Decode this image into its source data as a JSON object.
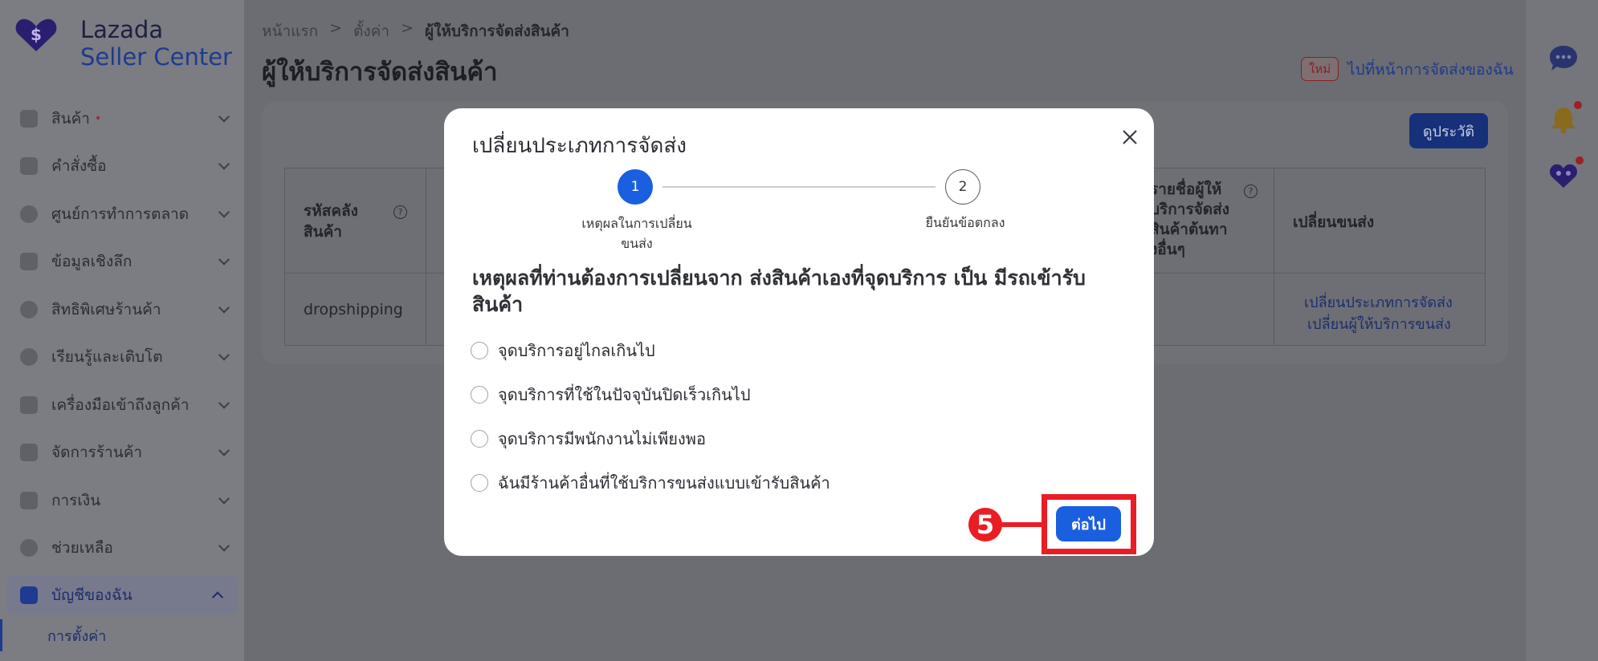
{
  "brand": {
    "line1": "Lazada",
    "line2": "Seller Center"
  },
  "sidebar": {
    "items": [
      {
        "label": "สินค้า",
        "badge": "•"
      },
      {
        "label": "คำสั่งซื้อ"
      },
      {
        "label": "ศูนย์การทำการตลาด"
      },
      {
        "label": "ข้อมูลเชิงลึก"
      },
      {
        "label": "สิทธิพิเศษร้านค้า"
      },
      {
        "label": "เรียนรู้และเติบโต"
      },
      {
        "label": "เครื่องมือเข้าถึงลูกค้า"
      },
      {
        "label": "จัดการร้านค้า"
      },
      {
        "label": "การเงิน"
      },
      {
        "label": "ช่วยเหลือ"
      },
      {
        "label": "บัญชีของฉัน"
      }
    ],
    "sub_item": "การตั้งค่า"
  },
  "breadcrumb": {
    "home": "หน้าแรก",
    "settings": "ตั้งค่า",
    "current": "ผู้ให้บริการจัดส่งสินค้า",
    "sep": ">"
  },
  "page": {
    "title": "ผู้ให้บริการจัดส่งสินค้า",
    "new_badge": "ใหม่",
    "goto_link": "ไปที่หน้าการจัดส่งของฉัน",
    "history_button": "ดูประวัติ"
  },
  "table": {
    "col_warehouse": "รหัสคลังสินค้า",
    "col_list": "รายชื่อผู้ให้บริการจัดส่งสินค้าต้นทางอื่นๆ",
    "col_change": "เปลี่ยนขนส่ง",
    "help": "?",
    "rows": [
      {
        "warehouse": "dropshipping",
        "link1": "เปลี่ยนประเภทการจัดส่ง",
        "link2": "เปลี่ยนผู้ให้บริการขนส่ง"
      }
    ]
  },
  "modal": {
    "title": "เปลี่ยนประเภทการจัดส่ง",
    "steps": [
      {
        "number": "1",
        "label": "เหตุผลในการเปลี่ยนขนส่ง"
      },
      {
        "number": "2",
        "label": "ยืนยันข้อตกลง"
      }
    ],
    "question": "เหตุผลที่ท่านต้องการเปลี่ยนจาก ส่งสินค้าเองที่จุดบริการ เป็น มีรถเข้ารับสินค้า",
    "options": [
      "จุดบริการอยู่ไกลเกินไป",
      "จุดบริการที่ใช้ในปัจจุบันปิดเร็วเกินไป",
      "จุดบริการมีพนักงานไม่เพียงพอ",
      "ฉันมีร้านค้าอื่นที่ใช้บริการขนส่งแบบเข้ารับสินค้า"
    ],
    "next_button": "ต่อไป"
  },
  "annotation": {
    "number": "5"
  },
  "colors": {
    "primary": "#1a5fe0",
    "annotation_red": "#ea1c24",
    "overlay": "#6b6d72"
  }
}
